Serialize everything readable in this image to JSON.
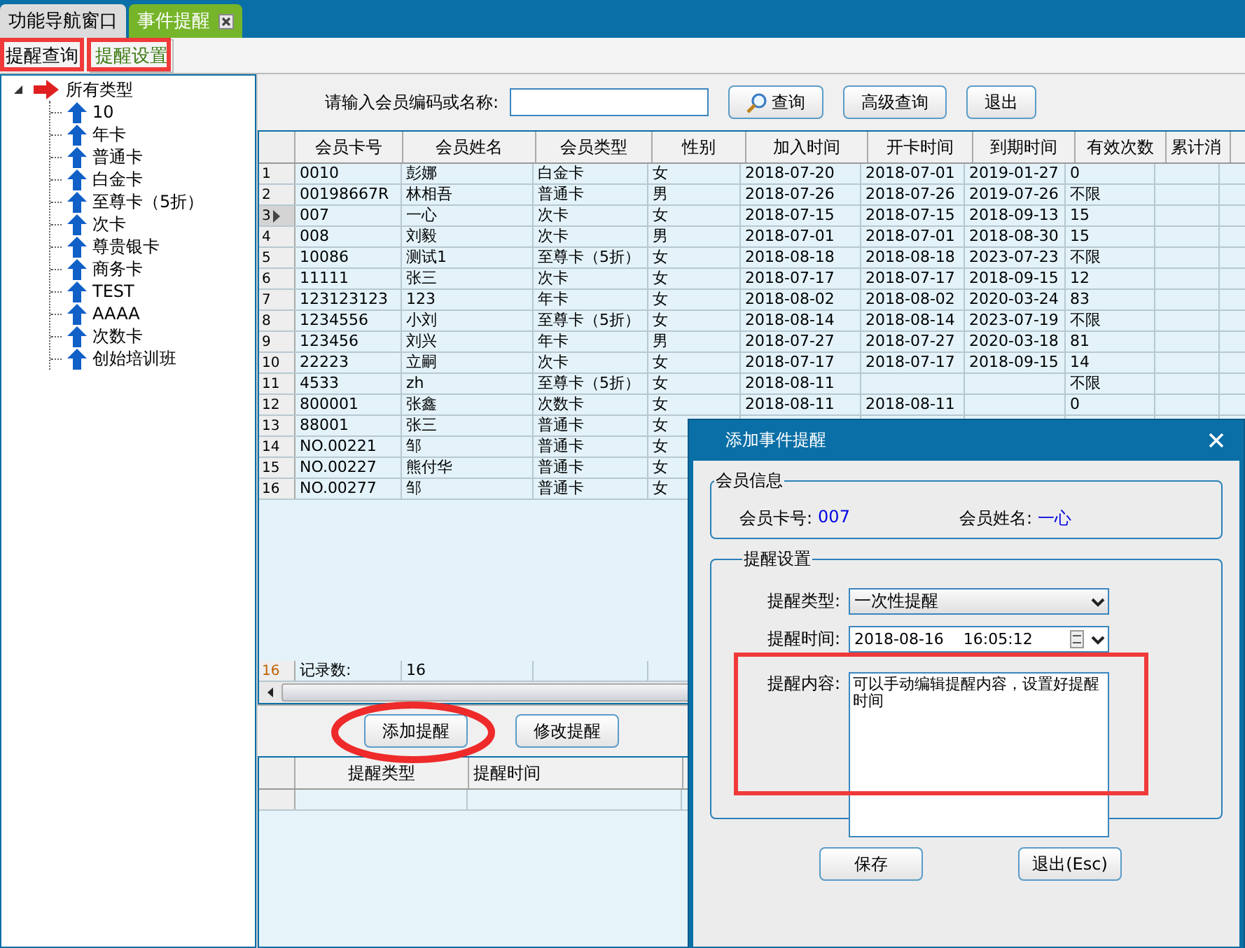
{
  "tabs": [
    {
      "label": "功能导航窗口",
      "selected": false,
      "closable": false
    },
    {
      "label": "事件提醒",
      "selected": true,
      "closable": true
    }
  ],
  "subtabs": [
    {
      "label": "提醒查询",
      "selected": false
    },
    {
      "label": "提醒设置",
      "selected": true
    }
  ],
  "tree": {
    "label": "所有类型",
    "expanded": true,
    "children": [
      {
        "label": "10"
      },
      {
        "label": "年卡"
      },
      {
        "label": "普通卡"
      },
      {
        "label": "白金卡"
      },
      {
        "label": "至尊卡（5折）"
      },
      {
        "label": "次卡"
      },
      {
        "label": "尊贵银卡"
      },
      {
        "label": "商务卡"
      },
      {
        "label": "TEST"
      },
      {
        "label": "AAAA"
      },
      {
        "label": "次数卡"
      },
      {
        "label": "创始培训班"
      }
    ]
  },
  "search": {
    "label": "请输入会员编码或名称:",
    "buttons": [
      {
        "label": "查询",
        "icon": true
      },
      {
        "label": "高级查询",
        "icon": false
      },
      {
        "label": "退出",
        "icon": false
      }
    ]
  },
  "members": {
    "columns": [
      "会员卡号",
      "会员姓名",
      "会员类型",
      "性别",
      "加入时间",
      "开卡时间",
      "到期时间",
      "有效次数",
      "累计消"
    ],
    "rows": [
      {
        "index": "1",
        "selected": false,
        "cells": [
          "0010",
          "彭娜",
          "白金卡",
          "女",
          "2018-07-20",
          "2018-07-01",
          "2019-01-27",
          "0"
        ]
      },
      {
        "index": "2",
        "selected": false,
        "cells": [
          "00198667R",
          "林相吾",
          "普通卡",
          "男",
          "2018-07-26",
          "2018-07-26",
          "2019-07-26",
          "不限"
        ]
      },
      {
        "index": "3",
        "selected": true,
        "cells": [
          "007",
          "一心",
          "次卡",
          "女",
          "2018-07-15",
          "2018-07-15",
          "2018-09-13",
          "15"
        ]
      },
      {
        "index": "4",
        "selected": false,
        "cells": [
          "008",
          "刘毅",
          "次卡",
          "男",
          "2018-07-01",
          "2018-07-01",
          "2018-08-30",
          "15"
        ]
      },
      {
        "index": "5",
        "selected": false,
        "cells": [
          "10086",
          "测试1",
          "至尊卡（5折）",
          "女",
          "2018-08-18",
          "2018-08-18",
          "2023-07-23",
          "不限"
        ]
      },
      {
        "index": "6",
        "selected": false,
        "cells": [
          "11111",
          "张三",
          "次卡",
          "女",
          "2018-07-17",
          "2018-07-17",
          "2018-09-15",
          "12"
        ]
      },
      {
        "index": "7",
        "selected": false,
        "cells": [
          "123123123",
          "123",
          "年卡",
          "女",
          "2018-08-02",
          "2018-08-02",
          "2020-03-24",
          "83"
        ]
      },
      {
        "index": "8",
        "selected": false,
        "cells": [
          "1234556",
          "小刘",
          "至尊卡（5折）",
          "女",
          "2018-08-14",
          "2018-08-14",
          "2023-07-19",
          "不限"
        ]
      },
      {
        "index": "9",
        "selected": false,
        "cells": [
          "123456",
          "刘兴",
          "年卡",
          "男",
          "2018-07-27",
          "2018-07-27",
          "2020-03-18",
          "81"
        ]
      },
      {
        "index": "10",
        "selected": false,
        "cells": [
          "22223",
          "立嗣",
          "次卡",
          "女",
          "2018-07-17",
          "2018-07-17",
          "2018-09-15",
          "14"
        ]
      },
      {
        "index": "11",
        "selected": false,
        "cells": [
          "4533",
          "zh",
          "至尊卡（5折）",
          "女",
          "2018-08-11",
          null,
          null,
          "不限"
        ]
      },
      {
        "index": "12",
        "selected": false,
        "cells": [
          "800001",
          "张鑫",
          "次数卡",
          "女",
          "2018-08-11",
          "2018-08-11",
          null,
          "0"
        ]
      },
      {
        "index": "13",
        "selected": false,
        "cells": [
          "88001",
          "张三",
          "普通卡",
          "女"
        ]
      },
      {
        "index": "14",
        "selected": false,
        "cells": [
          "NO.00221",
          "邹",
          "普通卡",
          "女"
        ]
      },
      {
        "index": "15",
        "selected": false,
        "cells": [
          "NO.00227",
          "熊付华",
          "普通卡",
          "女"
        ]
      },
      {
        "index": "16",
        "selected": false,
        "cells": [
          "NO.00277",
          "邹",
          "普通卡",
          "女"
        ]
      }
    ],
    "footer": {
      "index": "16",
      "label": "记录数:",
      "value": "16"
    }
  },
  "actions": [
    "添加提醒",
    "修改提醒"
  ],
  "reminders": {
    "columns": [
      "提醒类型",
      "提醒时间"
    ]
  },
  "dialog": {
    "title": "添加事件提醒",
    "member_group": {
      "title": "会员信息",
      "card_label": "会员卡号:",
      "card_value": "007",
      "name_label": "会员姓名:",
      "name_value": "一心"
    },
    "settings_group": {
      "title": "提醒设置",
      "type_label": "提醒类型:",
      "type_value": "一次性提醒",
      "time_label": "提醒时间:",
      "time_value": "2018-08-16    16:05:12",
      "content_label": "提醒内容:",
      "content_value": "可以手动编辑提醒内容，设置好提醒时间"
    },
    "buttons": [
      "保存",
      "退出(Esc)"
    ]
  }
}
